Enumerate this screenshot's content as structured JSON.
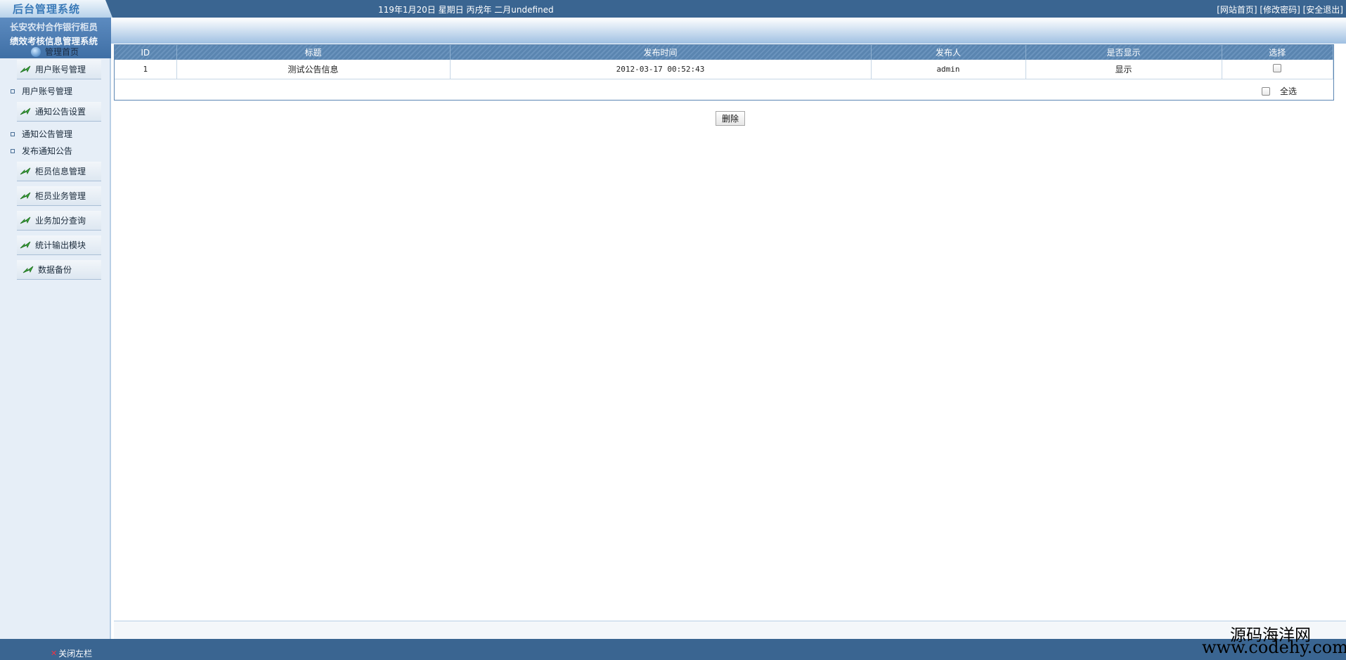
{
  "header": {
    "logo_text": "后台管理系统",
    "datetime": "119年1月20日 星期日 丙戌年 二月undefined",
    "links": [
      "[网站首页]",
      "[修改密码]",
      "[安全退出]"
    ]
  },
  "sidebar": {
    "title_line1": "长安农村合作银行柜员",
    "title_line2": "绩效考核信息管理系统",
    "home_label": "管理首页",
    "items": [
      {
        "type": "head",
        "label": "用户账号管理"
      },
      {
        "type": "sub",
        "label": "用户账号管理"
      },
      {
        "type": "head",
        "label": "通知公告设置"
      },
      {
        "type": "sub",
        "label": "通知公告管理"
      },
      {
        "type": "sub",
        "label": "发布通知公告"
      },
      {
        "type": "head",
        "label": "柜员信息管理"
      },
      {
        "type": "head",
        "label": "柜员业务管理"
      },
      {
        "type": "head",
        "label": "业务加分查询"
      },
      {
        "type": "head",
        "label": "统计输出模块"
      },
      {
        "type": "head",
        "label": "数据备份"
      }
    ]
  },
  "table": {
    "columns": [
      "ID",
      "标题",
      "发布时间",
      "发布人",
      "是否显示",
      "选择"
    ],
    "rows": [
      {
        "id": "1",
        "title": "测试公告信息",
        "time": "2012-03-17 00:52:43",
        "author": "admin",
        "visible": "显示"
      }
    ],
    "select_all_label": "全选"
  },
  "delete_button": "删除",
  "footer": {
    "close_sidebar": "关闭左栏"
  },
  "watermark": {
    "line1": "源码海洋网",
    "line2": "www.codehy.com"
  },
  "colors": {
    "topbar": "#3a6591",
    "header_cell": "#5a85b0",
    "sidebar": "#e6eef7"
  },
  "icons": {
    "menu_head": "green-arrow-icon",
    "home": "globe-icon",
    "close": "close-icon"
  }
}
